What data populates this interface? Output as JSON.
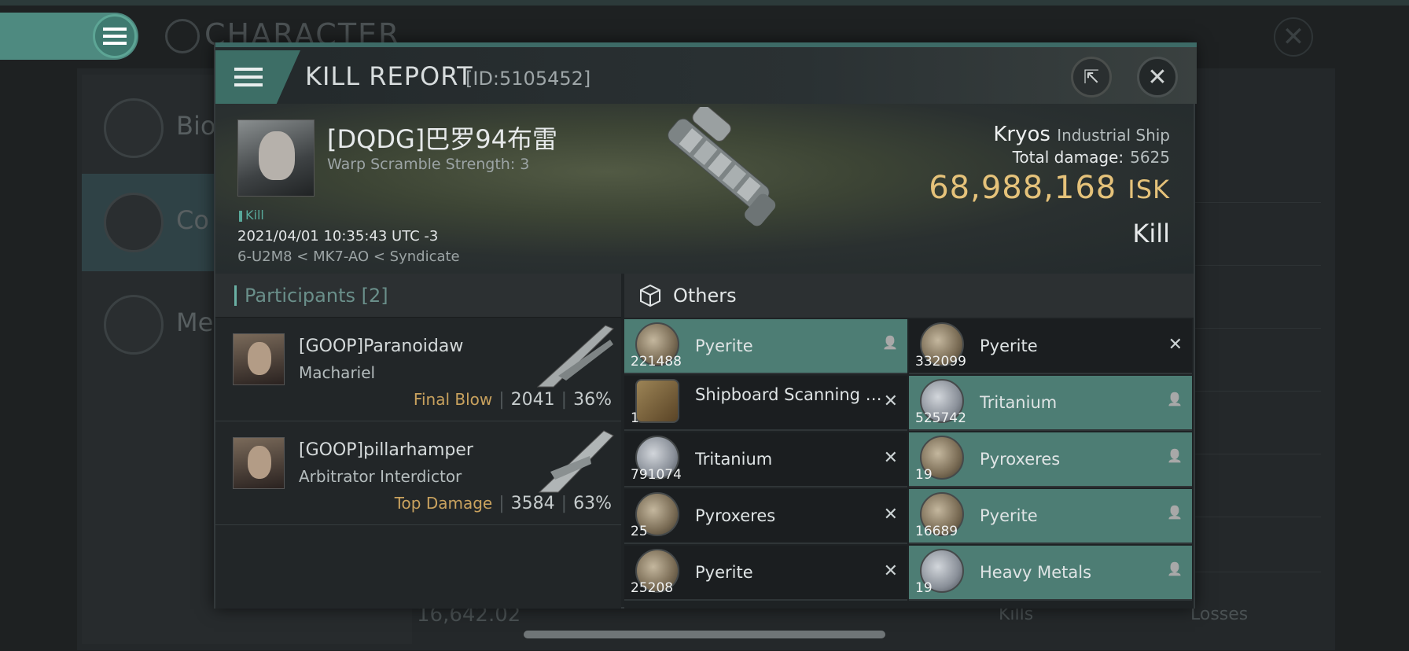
{
  "background": {
    "title": "CHARACTER",
    "side_items": [
      {
        "label": "Bio"
      },
      {
        "label": "Co"
      },
      {
        "label": "Me"
      }
    ],
    "bottom_value": "16,642.02",
    "kills_label": "Kills",
    "losses_label": "Losses"
  },
  "modal": {
    "title": "KILL REPORT",
    "id_label": "[ID:5105452]",
    "victim": {
      "name": "[DQDG]巴罗94布雷",
      "subtitle": "Warp Scramble Strength: 3",
      "tag": "Kill",
      "datetime": "2021/04/01 10:35:43 UTC -3",
      "location": "6-U2M8 < MK7-AO < Syndicate"
    },
    "ship": {
      "name": "Kryos",
      "class": "Industrial Ship",
      "damage_label": "Total damage:",
      "damage_value": "5625",
      "isk_value": "68,988,168",
      "isk_unit": "ISK",
      "kill_type": "Kill"
    },
    "participants": {
      "label": "Participants",
      "count": "[2]",
      "rows": [
        {
          "name": "[GOOP]Paranoidaw",
          "ship": "Machariel",
          "tag": "Final Blow",
          "damage": "2041",
          "percent": "36%"
        },
        {
          "name": "[GOOP]pillarhamper",
          "ship": "Arbitrator Interdictor",
          "tag": "Top Damage",
          "damage": "3584",
          "percent": "63%"
        }
      ]
    },
    "others": {
      "label": "Others",
      "items": [
        {
          "qty": "221488",
          "name": "Pyerite",
          "state": "dropped",
          "icon": "rock"
        },
        {
          "qty": "332099",
          "name": "Pyerite",
          "state": "destroyed",
          "icon": "rock"
        },
        {
          "qty": "1",
          "name": "Shipboard Scanning and...",
          "state": "destroyed",
          "icon": "book"
        },
        {
          "qty": "525742",
          "name": "Tritanium",
          "state": "dropped",
          "icon": "metal"
        },
        {
          "qty": "791074",
          "name": "Tritanium",
          "state": "destroyed",
          "icon": "metal"
        },
        {
          "qty": "19",
          "name": "Pyroxeres",
          "state": "dropped",
          "icon": "rock"
        },
        {
          "qty": "25",
          "name": "Pyroxeres",
          "state": "destroyed",
          "icon": "rock"
        },
        {
          "qty": "16689",
          "name": "Pyerite",
          "state": "dropped",
          "icon": "rock"
        },
        {
          "qty": "25208",
          "name": "Pyerite",
          "state": "destroyed",
          "icon": "rock"
        },
        {
          "qty": "19",
          "name": "Heavy Metals",
          "state": "dropped",
          "icon": "metal"
        }
      ]
    }
  },
  "colors": {
    "accent": "#4d7d74",
    "isk": "#e5c27a",
    "tag_gold": "#c9a25e"
  }
}
